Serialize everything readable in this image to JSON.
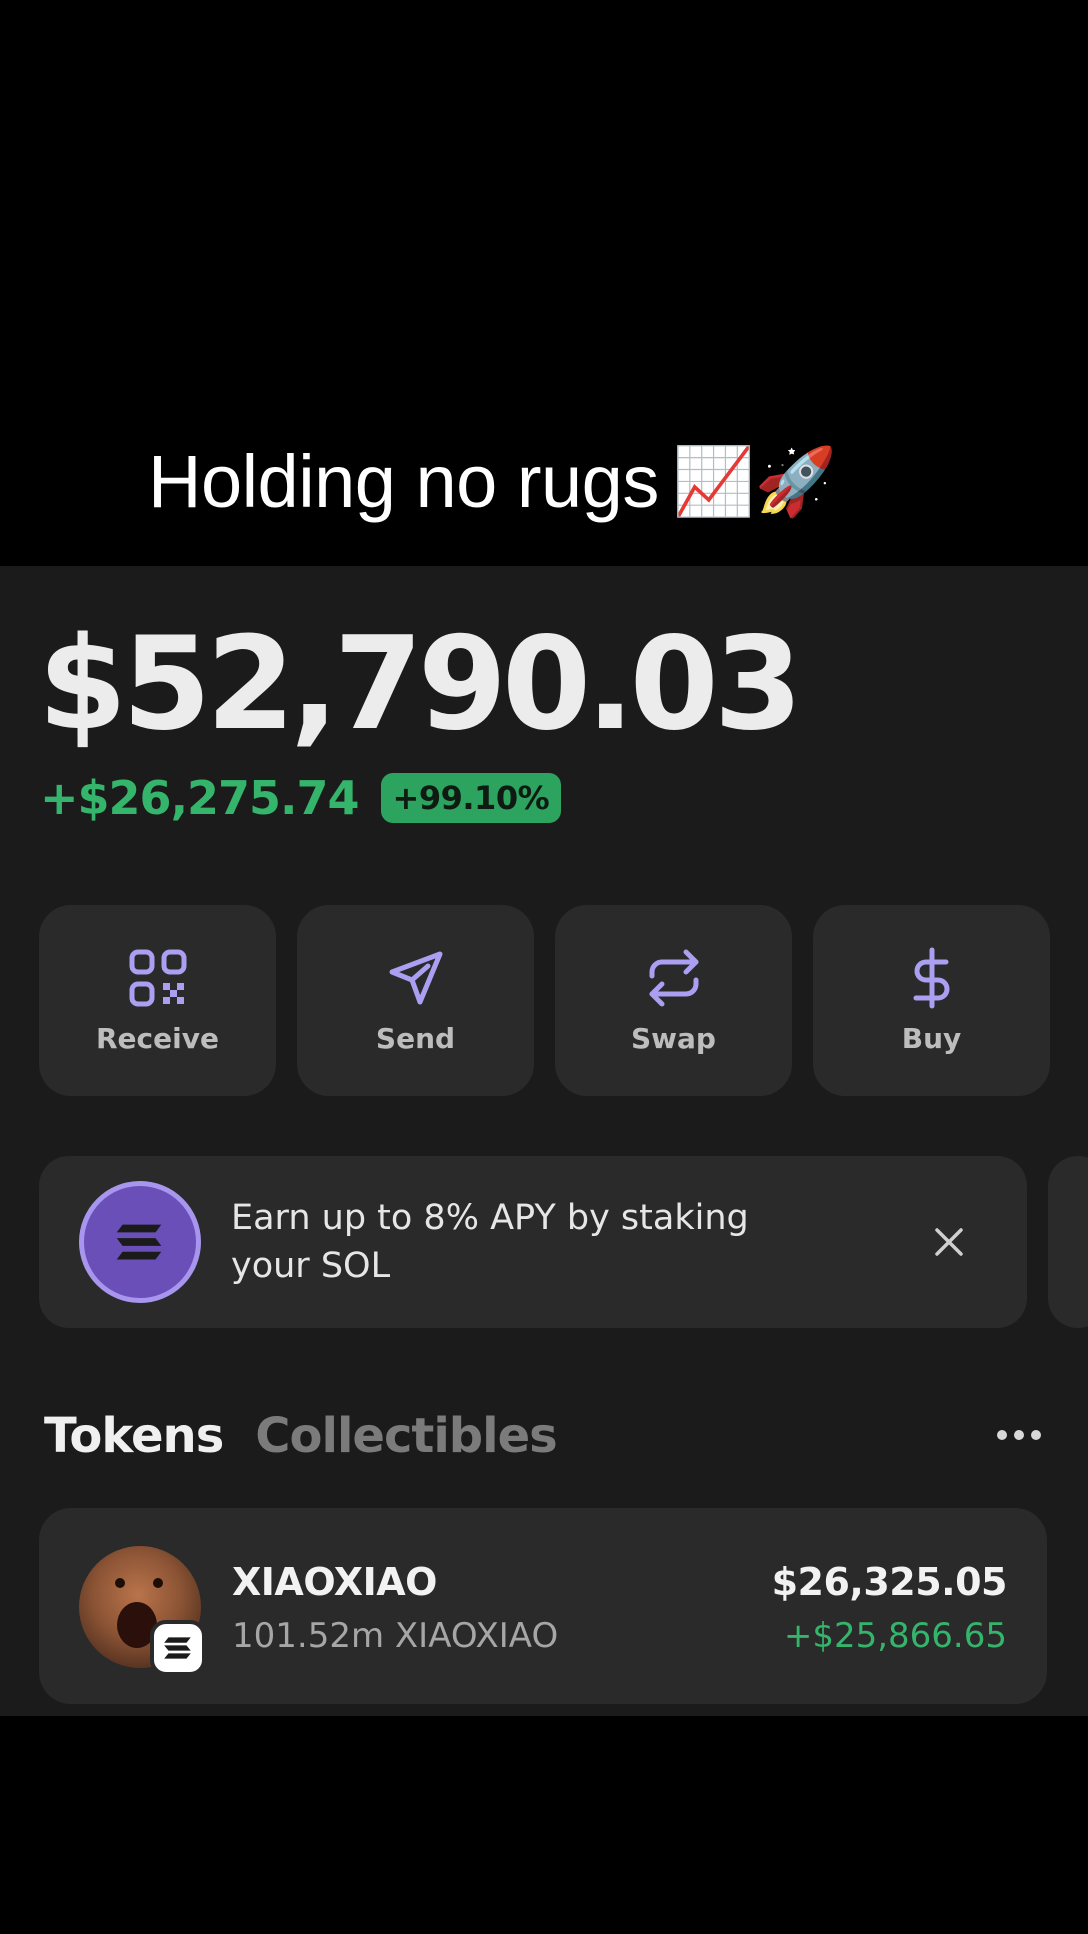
{
  "caption": {
    "text": "Holding no rugs",
    "emoji_chart": "📈",
    "emoji_rocket": "🚀"
  },
  "wallet": {
    "balance": "$52,790.03",
    "change_amount": "+$26,275.74",
    "change_percent": "+99.10%"
  },
  "actions": [
    {
      "label": "Receive",
      "icon": "qr-code-icon"
    },
    {
      "label": "Send",
      "icon": "send-icon"
    },
    {
      "label": "Swap",
      "icon": "swap-icon"
    },
    {
      "label": "Buy",
      "icon": "dollar-icon"
    }
  ],
  "promo": {
    "text": "Earn up to 8% APY by staking your SOL",
    "icon": "solana-icon"
  },
  "tabs": [
    {
      "label": "Tokens",
      "active": true
    },
    {
      "label": "Collectibles",
      "active": false
    }
  ],
  "tokens": [
    {
      "name": "XIAOXIAO",
      "amount": "101.52m XIAOXIAO",
      "value": "$26,325.05",
      "change": "+$25,866.65"
    }
  ],
  "colors": {
    "accent": "#ab9ff2",
    "positive": "#35b56b",
    "surface": "#2a2a2a",
    "background": "#1b1b1b"
  }
}
